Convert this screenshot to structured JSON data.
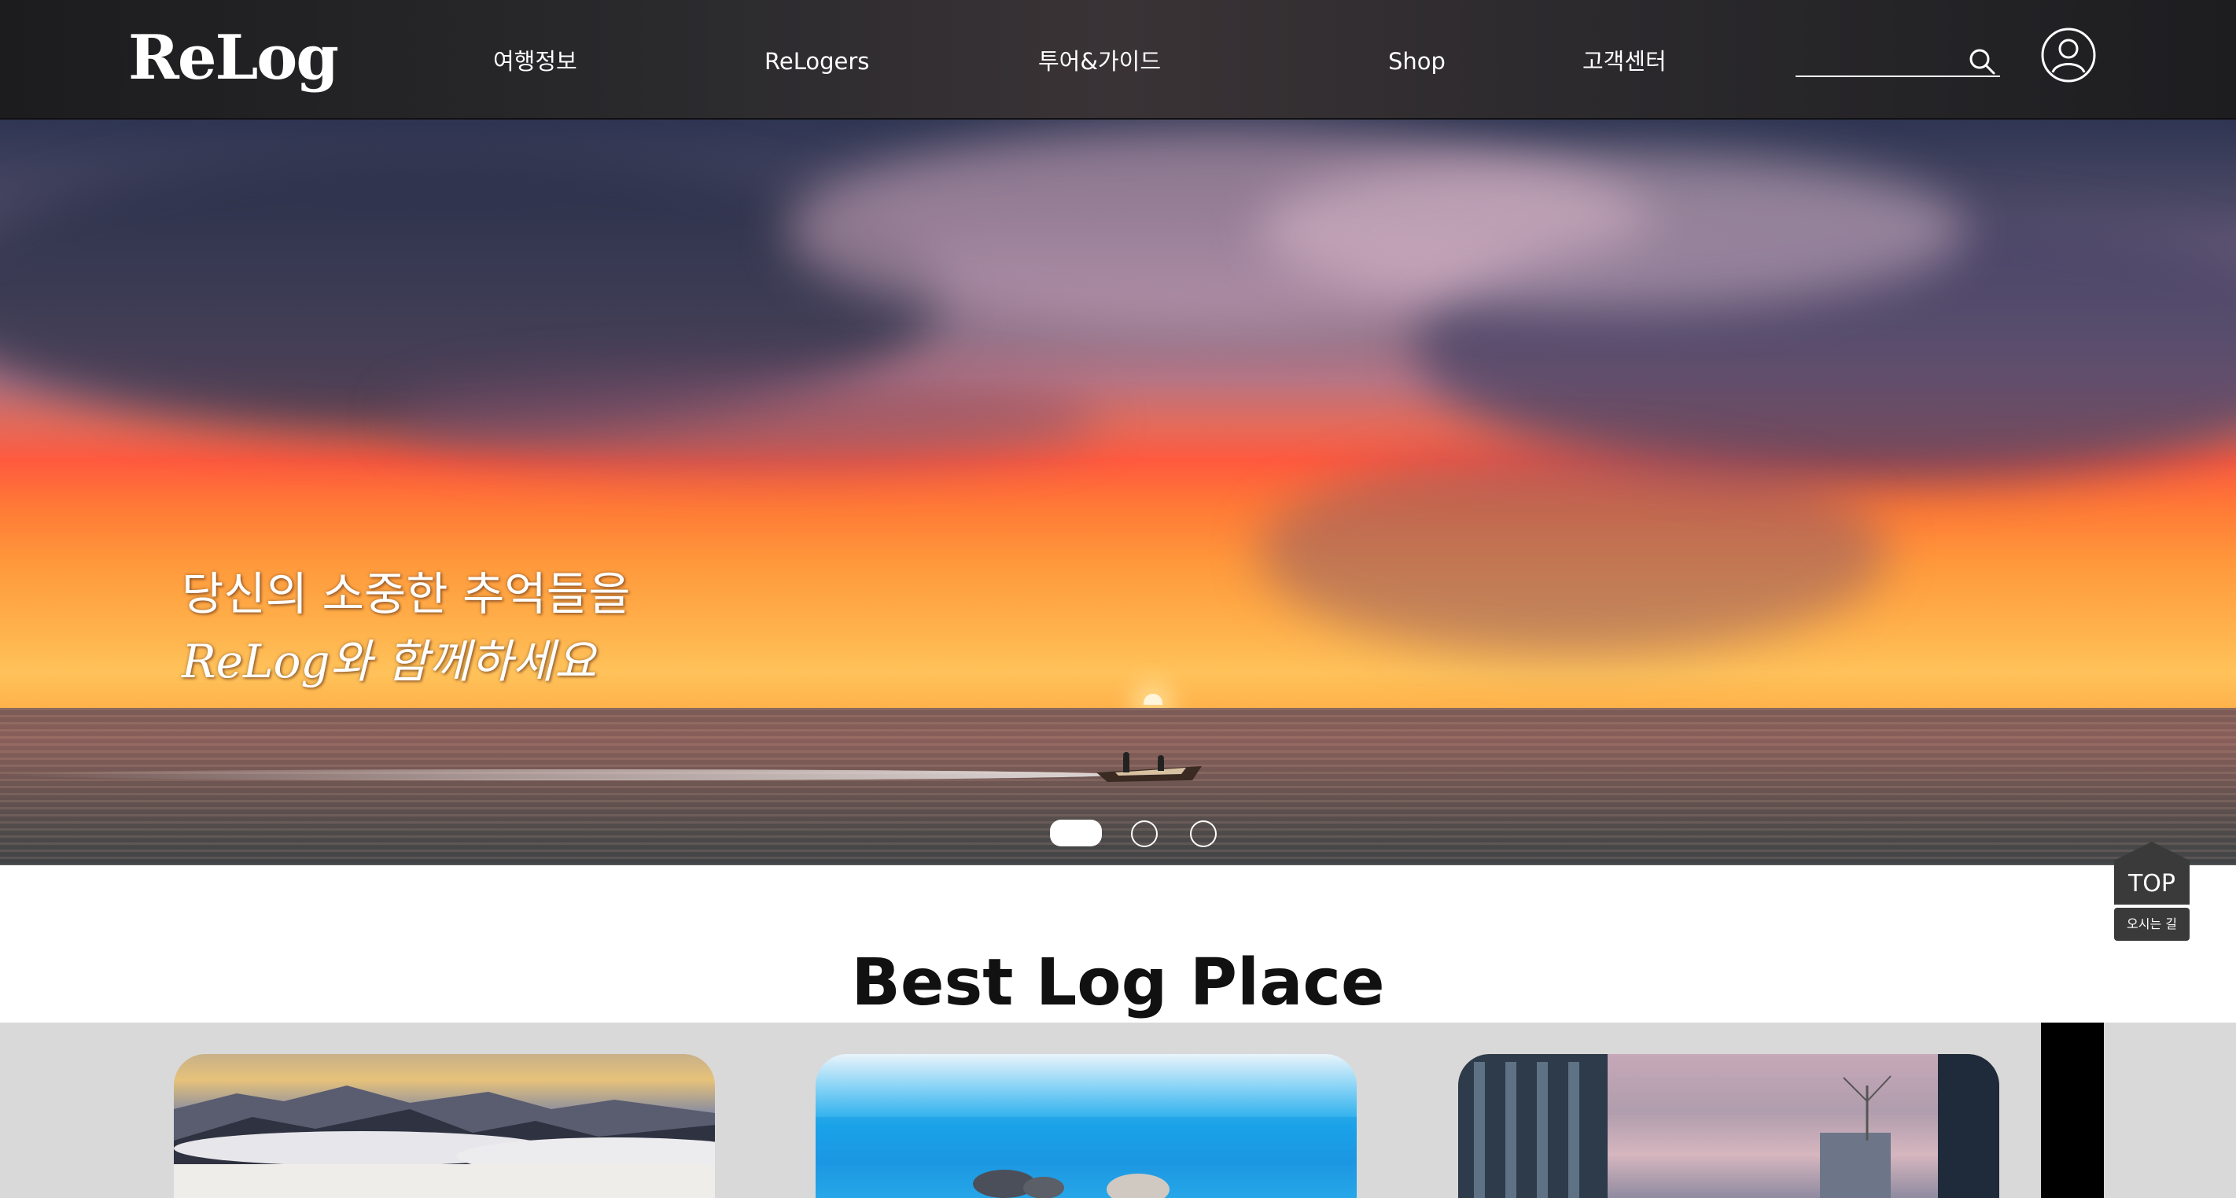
{
  "header": {
    "logo": "ReLog",
    "nav": [
      {
        "label": "여행정보"
      },
      {
        "label": "ReLogers"
      },
      {
        "label": "투어&가이드"
      },
      {
        "label": "Shop"
      },
      {
        "label": "고객센터"
      }
    ],
    "search": {
      "placeholder": "",
      "icon": "search-icon"
    },
    "user_icon": "user-icon"
  },
  "hero": {
    "line1": "당신의 소중한 추억들을",
    "line2": "ReLog와 함께하세요",
    "slides": {
      "count": 3,
      "active": 1
    }
  },
  "floating": {
    "top_label": "TOP",
    "directions_label": "오시는 길"
  },
  "best_places": {
    "title": "Best Log Place",
    "cards": [
      {
        "name": "mountain-clouds"
      },
      {
        "name": "blue-sea"
      },
      {
        "name": "city-buildings"
      }
    ]
  },
  "colors": {
    "header_bg": "#222225",
    "section_bg": "#d9d9d9",
    "floating_bg": "#3a3a3a"
  }
}
